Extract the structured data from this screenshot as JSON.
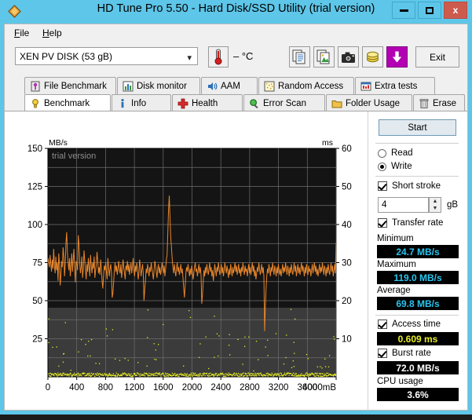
{
  "window": {
    "title": "HD Tune Pro 5.50 - Hard Disk/SSD Utility (trial version)",
    "minimize_label": "",
    "maximize_label": "",
    "close_label": "x",
    "app_icon": "diamond-orange-icon"
  },
  "menu": {
    "items": [
      {
        "label": "File",
        "accel": "F"
      },
      {
        "label": "Help",
        "accel": "H"
      }
    ]
  },
  "toolbar": {
    "drive": "XEN    PV DISK (53 gB)",
    "drive_icon": "chevron-down-icon",
    "temperature": "– °C",
    "thermometer_icon": "thermometer-icon",
    "buttons": [
      {
        "name": "copy-text-icon",
        "label": ""
      },
      {
        "name": "copy-image-icon",
        "label": ""
      },
      {
        "name": "camera-icon",
        "label": ""
      },
      {
        "name": "coins-icon",
        "label": ""
      },
      {
        "name": "download-arrow-icon",
        "label": ""
      }
    ],
    "exit_label": "Exit"
  },
  "tabs": {
    "row1": [
      {
        "label": "File Benchmark",
        "icon": "file-benchmark-icon",
        "active": false
      },
      {
        "label": "Disk monitor",
        "icon": "disk-monitor-icon",
        "active": false
      },
      {
        "label": "AAM",
        "icon": "speaker-icon",
        "active": false
      },
      {
        "label": "Random Access",
        "icon": "random-access-icon",
        "active": false
      },
      {
        "label": "Extra tests",
        "icon": "extra-tests-icon",
        "active": false
      }
    ],
    "row2": [
      {
        "label": "Benchmark",
        "icon": "benchmark-bulb-icon",
        "active": true
      },
      {
        "label": "Info",
        "icon": "info-icon",
        "active": false
      },
      {
        "label": "Health",
        "icon": "health-cross-icon",
        "active": false
      },
      {
        "label": "Error Scan",
        "icon": "magnifier-icon",
        "active": false
      },
      {
        "label": "Folder Usage",
        "icon": "folder-icon",
        "active": false
      },
      {
        "label": "Erase",
        "icon": "trash-icon",
        "active": false
      }
    ]
  },
  "panel": {
    "start_label": "Start",
    "mode": {
      "read_label": "Read",
      "write_label": "Write",
      "selected": "Write"
    },
    "short_stroke": {
      "label": "Short stroke",
      "checked": true,
      "value": "4",
      "unit": "gB"
    },
    "transfer_rate": {
      "label": "Transfer rate",
      "checked": true
    },
    "stats": [
      {
        "label": "Minimum",
        "value": "24.7 MB/s",
        "color": "#27c5ee"
      },
      {
        "label": "Maximum",
        "value": "119.0 MB/s",
        "color": "#27c5ee"
      },
      {
        "label": "Average",
        "value": "69.8 MB/s",
        "color": "#27c5ee"
      }
    ],
    "access_time": {
      "label": "Access time",
      "checked": true,
      "value": "0.609 ms",
      "color": "#e8ef24"
    },
    "burst_rate": {
      "label": "Burst rate",
      "checked": true,
      "value": "72.0 MB/s",
      "color": "#ffffff"
    },
    "cpu_usage": {
      "label": "CPU usage",
      "value": "3.6%",
      "color": "#ffffff"
    }
  },
  "chart_data": {
    "type": "line",
    "title": "",
    "watermark": "trial version",
    "ylabel": "MB/s",
    "y2label": "ms",
    "xlabel": "mB",
    "xlim": [
      0,
      4000
    ],
    "ylim": [
      0,
      150
    ],
    "y2lim": [
      0,
      60
    ],
    "yticks": [
      25,
      50,
      75,
      100,
      125,
      150
    ],
    "y2ticks": [
      10,
      20,
      30,
      40,
      50,
      60
    ],
    "xticks": [
      0,
      400,
      800,
      1200,
      1600,
      2000,
      2400,
      2800,
      3200,
      3600,
      4000
    ],
    "xtick_labels": [
      "0",
      "400",
      "800",
      "1200",
      "1600",
      "2000",
      "2400",
      "2800",
      "3200",
      "3600",
      "4000mB"
    ],
    "grid": true,
    "plot_bg": "#1a1a1a",
    "plot_bg_lower": "#3a3a3a",
    "series": [
      {
        "name": "Transfer rate",
        "color": "#e8862b",
        "axis": "left",
        "unit": "MB/s",
        "values": [
          78,
          75,
          72,
          80,
          74,
          69,
          77,
          71,
          84,
          73,
          68,
          79,
          70,
          75,
          63,
          81,
          74,
          60,
          67,
          76,
          72,
          85,
          79,
          66,
          74,
          88,
          95,
          82,
          75,
          70,
          78,
          66,
          73,
          81,
          69,
          77,
          84,
          71,
          62,
          76,
          74,
          70,
          93,
          87,
          75,
          68,
          72,
          79,
          65,
          71,
          83,
          76,
          70,
          64,
          74,
          69,
          78,
          72,
          66,
          80,
          73,
          68,
          75,
          71,
          79,
          65,
          70,
          74,
          82,
          76,
          68,
          72,
          67,
          77,
          71,
          63,
          58,
          66,
          73,
          70,
          75,
          69,
          64,
          78,
          72,
          66,
          71,
          74,
          68,
          52,
          55,
          62,
          70,
          75,
          69,
          73,
          67,
          71,
          76,
          70,
          68,
          74,
          65,
          70,
          77,
          72,
          68,
          64,
          73,
          70,
          76,
          69,
          74,
          67,
          71,
          75,
          68,
          72,
          78,
          70,
          66,
          73,
          69,
          75,
          71,
          64,
          68,
          77,
          72,
          66,
          70,
          74,
          68,
          50,
          57,
          63,
          71,
          68,
          74,
          70,
          66,
          72,
          69,
          75,
          71,
          68,
          64,
          70,
          76,
          73,
          69,
          65,
          71,
          74,
          68,
          72,
          67,
          70,
          75,
          71,
          68,
          73,
          66,
          71,
          77,
          80,
          95,
          110,
          119,
          105,
          92,
          85,
          78,
          72,
          68,
          74,
          70,
          66,
          71,
          75,
          69,
          72,
          67,
          70,
          74,
          68,
          71,
          65,
          58,
          52,
          60,
          68,
          72,
          69,
          74,
          70,
          66,
          71,
          67,
          73,
          70,
          64,
          68,
          72,
          75,
          69,
          71,
          66,
          70,
          74,
          68,
          72,
          67,
          48,
          54,
          62,
          70,
          66,
          72,
          68,
          74,
          70,
          67,
          71,
          75,
          69,
          72,
          66,
          70,
          63,
          68,
          74,
          70,
          66,
          72,
          69,
          75,
          71,
          67,
          70,
          74,
          68,
          72,
          66,
          70,
          75,
          71,
          68,
          73,
          69,
          65,
          71,
          67,
          74,
          70,
          66,
          72,
          68,
          71,
          75,
          69,
          73,
          67,
          70,
          74,
          68,
          71,
          66,
          72,
          69,
          75,
          70,
          67,
          73,
          69,
          71,
          66,
          70,
          74,
          68,
          72,
          67,
          71,
          75,
          69,
          73,
          66,
          70,
          64,
          68,
          72,
          69,
          75,
          71,
          67,
          70,
          74,
          68,
          72,
          66,
          30,
          45,
          58,
          66,
          71,
          68,
          74,
          70,
          66,
          72,
          69,
          75,
          71,
          67,
          73,
          70,
          66,
          72,
          68,
          74,
          70,
          67,
          71,
          66,
          70,
          74,
          68,
          72,
          69,
          75,
          71,
          67,
          73,
          70,
          66,
          72,
          68,
          74,
          70,
          67,
          71,
          75,
          69,
          73,
          66,
          70,
          74,
          68,
          72,
          67,
          71,
          75,
          69,
          73,
          70,
          66,
          72,
          68,
          74,
          70,
          67,
          73,
          69,
          71,
          66,
          70,
          74,
          68,
          72,
          75,
          69,
          73,
          67,
          71,
          66,
          70,
          74,
          68,
          72,
          69,
          75,
          71,
          67,
          73,
          70,
          66,
          72,
          68,
          74,
          70,
          67,
          71,
          75,
          69,
          73,
          66,
          70,
          74,
          68,
          88
        ]
      },
      {
        "name": "Access time",
        "color": "#e8ef24",
        "axis": "right",
        "unit": "ms",
        "mean": 0.609,
        "note": "scatter of access time samples near 0-2 ms, plotted as dots along bottom of plot"
      }
    ]
  }
}
